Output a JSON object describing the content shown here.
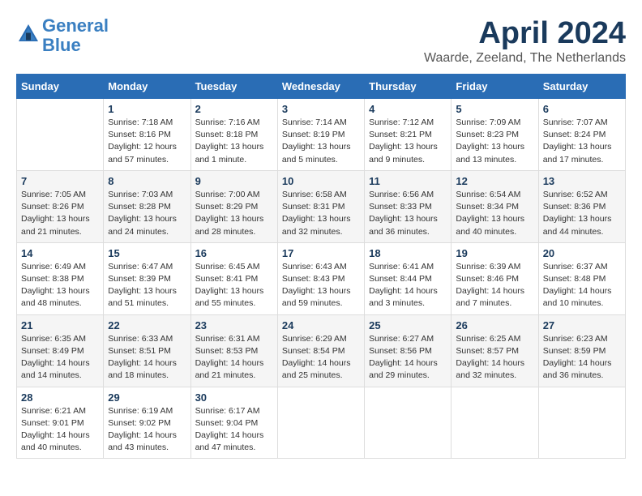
{
  "header": {
    "logo_line1": "General",
    "logo_line2": "Blue",
    "month": "April 2024",
    "location": "Waarde, Zeeland, The Netherlands"
  },
  "weekdays": [
    "Sunday",
    "Monday",
    "Tuesday",
    "Wednesday",
    "Thursday",
    "Friday",
    "Saturday"
  ],
  "weeks": [
    [
      {
        "day": "",
        "lines": []
      },
      {
        "day": "1",
        "lines": [
          "Sunrise: 7:18 AM",
          "Sunset: 8:16 PM",
          "Daylight: 12 hours",
          "and 57 minutes."
        ]
      },
      {
        "day": "2",
        "lines": [
          "Sunrise: 7:16 AM",
          "Sunset: 8:18 PM",
          "Daylight: 13 hours",
          "and 1 minute."
        ]
      },
      {
        "day": "3",
        "lines": [
          "Sunrise: 7:14 AM",
          "Sunset: 8:19 PM",
          "Daylight: 13 hours",
          "and 5 minutes."
        ]
      },
      {
        "day": "4",
        "lines": [
          "Sunrise: 7:12 AM",
          "Sunset: 8:21 PM",
          "Daylight: 13 hours",
          "and 9 minutes."
        ]
      },
      {
        "day": "5",
        "lines": [
          "Sunrise: 7:09 AM",
          "Sunset: 8:23 PM",
          "Daylight: 13 hours",
          "and 13 minutes."
        ]
      },
      {
        "day": "6",
        "lines": [
          "Sunrise: 7:07 AM",
          "Sunset: 8:24 PM",
          "Daylight: 13 hours",
          "and 17 minutes."
        ]
      }
    ],
    [
      {
        "day": "7",
        "lines": [
          "Sunrise: 7:05 AM",
          "Sunset: 8:26 PM",
          "Daylight: 13 hours",
          "and 21 minutes."
        ]
      },
      {
        "day": "8",
        "lines": [
          "Sunrise: 7:03 AM",
          "Sunset: 8:28 PM",
          "Daylight: 13 hours",
          "and 24 minutes."
        ]
      },
      {
        "day": "9",
        "lines": [
          "Sunrise: 7:00 AM",
          "Sunset: 8:29 PM",
          "Daylight: 13 hours",
          "and 28 minutes."
        ]
      },
      {
        "day": "10",
        "lines": [
          "Sunrise: 6:58 AM",
          "Sunset: 8:31 PM",
          "Daylight: 13 hours",
          "and 32 minutes."
        ]
      },
      {
        "day": "11",
        "lines": [
          "Sunrise: 6:56 AM",
          "Sunset: 8:33 PM",
          "Daylight: 13 hours",
          "and 36 minutes."
        ]
      },
      {
        "day": "12",
        "lines": [
          "Sunrise: 6:54 AM",
          "Sunset: 8:34 PM",
          "Daylight: 13 hours",
          "and 40 minutes."
        ]
      },
      {
        "day": "13",
        "lines": [
          "Sunrise: 6:52 AM",
          "Sunset: 8:36 PM",
          "Daylight: 13 hours",
          "and 44 minutes."
        ]
      }
    ],
    [
      {
        "day": "14",
        "lines": [
          "Sunrise: 6:49 AM",
          "Sunset: 8:38 PM",
          "Daylight: 13 hours",
          "and 48 minutes."
        ]
      },
      {
        "day": "15",
        "lines": [
          "Sunrise: 6:47 AM",
          "Sunset: 8:39 PM",
          "Daylight: 13 hours",
          "and 51 minutes."
        ]
      },
      {
        "day": "16",
        "lines": [
          "Sunrise: 6:45 AM",
          "Sunset: 8:41 PM",
          "Daylight: 13 hours",
          "and 55 minutes."
        ]
      },
      {
        "day": "17",
        "lines": [
          "Sunrise: 6:43 AM",
          "Sunset: 8:43 PM",
          "Daylight: 13 hours",
          "and 59 minutes."
        ]
      },
      {
        "day": "18",
        "lines": [
          "Sunrise: 6:41 AM",
          "Sunset: 8:44 PM",
          "Daylight: 14 hours",
          "and 3 minutes."
        ]
      },
      {
        "day": "19",
        "lines": [
          "Sunrise: 6:39 AM",
          "Sunset: 8:46 PM",
          "Daylight: 14 hours",
          "and 7 minutes."
        ]
      },
      {
        "day": "20",
        "lines": [
          "Sunrise: 6:37 AM",
          "Sunset: 8:48 PM",
          "Daylight: 14 hours",
          "and 10 minutes."
        ]
      }
    ],
    [
      {
        "day": "21",
        "lines": [
          "Sunrise: 6:35 AM",
          "Sunset: 8:49 PM",
          "Daylight: 14 hours",
          "and 14 minutes."
        ]
      },
      {
        "day": "22",
        "lines": [
          "Sunrise: 6:33 AM",
          "Sunset: 8:51 PM",
          "Daylight: 14 hours",
          "and 18 minutes."
        ]
      },
      {
        "day": "23",
        "lines": [
          "Sunrise: 6:31 AM",
          "Sunset: 8:53 PM",
          "Daylight: 14 hours",
          "and 21 minutes."
        ]
      },
      {
        "day": "24",
        "lines": [
          "Sunrise: 6:29 AM",
          "Sunset: 8:54 PM",
          "Daylight: 14 hours",
          "and 25 minutes."
        ]
      },
      {
        "day": "25",
        "lines": [
          "Sunrise: 6:27 AM",
          "Sunset: 8:56 PM",
          "Daylight: 14 hours",
          "and 29 minutes."
        ]
      },
      {
        "day": "26",
        "lines": [
          "Sunrise: 6:25 AM",
          "Sunset: 8:57 PM",
          "Daylight: 14 hours",
          "and 32 minutes."
        ]
      },
      {
        "day": "27",
        "lines": [
          "Sunrise: 6:23 AM",
          "Sunset: 8:59 PM",
          "Daylight: 14 hours",
          "and 36 minutes."
        ]
      }
    ],
    [
      {
        "day": "28",
        "lines": [
          "Sunrise: 6:21 AM",
          "Sunset: 9:01 PM",
          "Daylight: 14 hours",
          "and 40 minutes."
        ]
      },
      {
        "day": "29",
        "lines": [
          "Sunrise: 6:19 AM",
          "Sunset: 9:02 PM",
          "Daylight: 14 hours",
          "and 43 minutes."
        ]
      },
      {
        "day": "30",
        "lines": [
          "Sunrise: 6:17 AM",
          "Sunset: 9:04 PM",
          "Daylight: 14 hours",
          "and 47 minutes."
        ]
      },
      {
        "day": "",
        "lines": []
      },
      {
        "day": "",
        "lines": []
      },
      {
        "day": "",
        "lines": []
      },
      {
        "day": "",
        "lines": []
      }
    ]
  ]
}
